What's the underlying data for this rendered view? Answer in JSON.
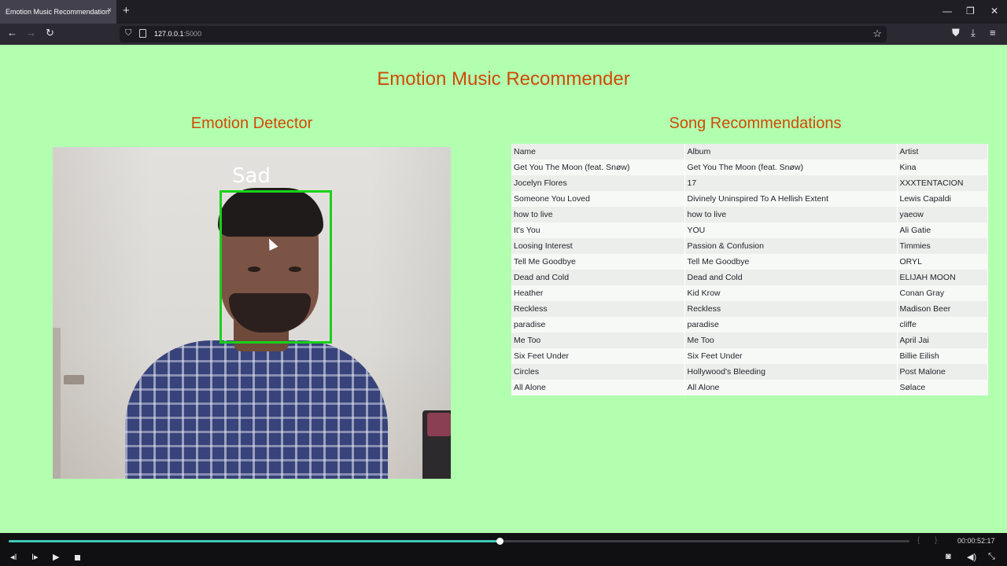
{
  "browser": {
    "tab_title": "Emotion Music Recommendation",
    "tab_close": "×",
    "new_tab": "+",
    "url_host": "127.0.0.1",
    "url_port": ":5000",
    "icons": [
      "back-arrow-icon",
      "forward-arrow-icon",
      "reload-icon",
      "shield-icon",
      "page-icon",
      "star-icon",
      "pocket-icon",
      "download-icon",
      "menu-icon"
    ]
  },
  "page": {
    "title": "Emotion Music Recommender",
    "detector_title": "Emotion Detector",
    "recommendations_title": "Song Recommendations",
    "detected_emotion": "Sad"
  },
  "table": {
    "headers": {
      "name": "Name",
      "album": "Album",
      "artist": "Artist"
    },
    "rows": [
      {
        "name": "Get You The Moon (feat. Snøw)",
        "album": "Get You The Moon (feat. Snøw)",
        "artist": "Kina"
      },
      {
        "name": "Jocelyn Flores",
        "album": "17",
        "artist": "XXXTENTACION"
      },
      {
        "name": "Someone You Loved",
        "album": "Divinely Uninspired To A Hellish Extent",
        "artist": "Lewis Capaldi"
      },
      {
        "name": "how to live",
        "album": "how to live",
        "artist": "yaeow"
      },
      {
        "name": "It's You",
        "album": "YOU",
        "artist": "Ali Gatie"
      },
      {
        "name": "Loosing Interest",
        "album": "Passion & Confusion",
        "artist": "Timmies"
      },
      {
        "name": "Tell Me Goodbye",
        "album": "Tell Me Goodbye",
        "artist": "ORYL"
      },
      {
        "name": "Dead and Cold",
        "album": "Dead and Cold",
        "artist": "ELIJAH MOON"
      },
      {
        "name": "Heather",
        "album": "Kid Krow",
        "artist": "Conan Gray"
      },
      {
        "name": "Reckless",
        "album": "Reckless",
        "artist": "Madison Beer"
      },
      {
        "name": "paradise",
        "album": "paradise",
        "artist": "cliffe"
      },
      {
        "name": "Me Too",
        "album": "Me Too",
        "artist": "April Jai"
      },
      {
        "name": "Six Feet Under",
        "album": "Six Feet Under",
        "artist": "Billie Eilish"
      },
      {
        "name": "Circles",
        "album": "Hollywood's Bleeding",
        "artist": "Post Malone"
      },
      {
        "name": "All Alone",
        "album": "All Alone",
        "artist": "Sølace"
      }
    ]
  },
  "player": {
    "timecode": "00:00:52:17",
    "progress": 0.545,
    "accent_color": "#3fc9b5"
  },
  "colors": {
    "page_background": "#b2ffb0",
    "heading": "#d04a05",
    "face_box": "#19d119"
  }
}
